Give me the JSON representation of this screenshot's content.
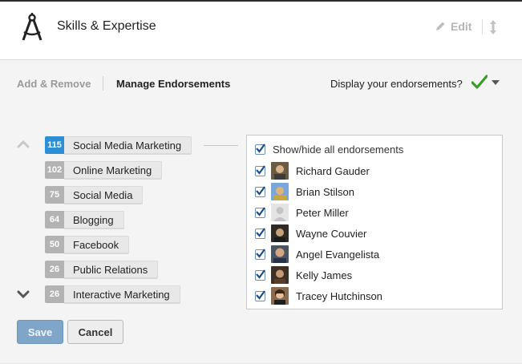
{
  "header": {
    "title": "Skills & Expertise",
    "edit_label": "Edit"
  },
  "tabs": {
    "add_remove": "Add & Remove",
    "manage": "Manage Endorsements"
  },
  "display_prompt": "Display your endorsements?",
  "skills": [
    {
      "count": "115",
      "label": "Social Media Marketing"
    },
    {
      "count": "102",
      "label": "Online Marketing"
    },
    {
      "count": "75",
      "label": "Social Media"
    },
    {
      "count": "64",
      "label": "Blogging"
    },
    {
      "count": "50",
      "label": "Facebook"
    },
    {
      "count": "26",
      "label": "Public Relations"
    },
    {
      "count": "26",
      "label": "Interactive Marketing"
    }
  ],
  "endorsements": {
    "show_all_label": "Show/hide all endorsements",
    "people": [
      {
        "name": "Richard Gauder"
      },
      {
        "name": "Brian Stilson"
      },
      {
        "name": "Peter Miller"
      },
      {
        "name": "Wayne Couvier"
      },
      {
        "name": "Angel Evangelista"
      },
      {
        "name": "Kelly James"
      },
      {
        "name": "Tracey Hutchinson"
      }
    ]
  },
  "buttons": {
    "save": "Save",
    "cancel": "Cancel"
  },
  "colors": {
    "accent_blue": "#2c8fd6",
    "check_green": "#3a9a2b",
    "save_button": "#7fa6c9"
  }
}
